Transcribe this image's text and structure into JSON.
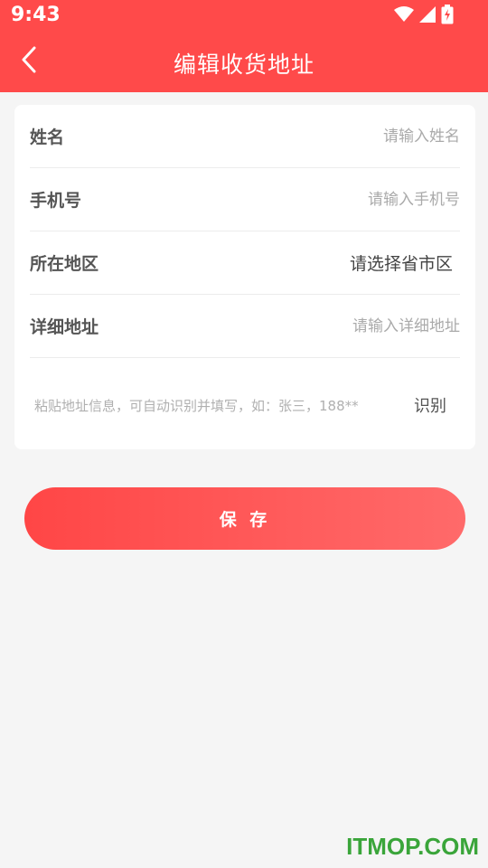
{
  "status_bar": {
    "time": "9:43",
    "icons": [
      "wifi-icon",
      "signal-icon",
      "battery-charging-icon"
    ]
  },
  "header": {
    "title": "编辑收货地址",
    "back_icon": "chevron-left-icon"
  },
  "form": {
    "name": {
      "label": "姓名",
      "placeholder": "请输入姓名",
      "value": ""
    },
    "phone": {
      "label": "手机号",
      "placeholder": "请输入手机号",
      "value": ""
    },
    "region": {
      "label": "所在地区",
      "value": "请选择省市区"
    },
    "detail": {
      "label": "详细地址",
      "placeholder": "请输入详细地址",
      "value": ""
    },
    "paste": {
      "hint": "粘贴地址信息，可自动识别并填写，如：张三，188**",
      "action": "识别"
    }
  },
  "save_label": "保 存",
  "watermark": "ITMOP.COM",
  "colors": {
    "brand": "#ff4a4a",
    "watermark": "#3aa53a"
  }
}
